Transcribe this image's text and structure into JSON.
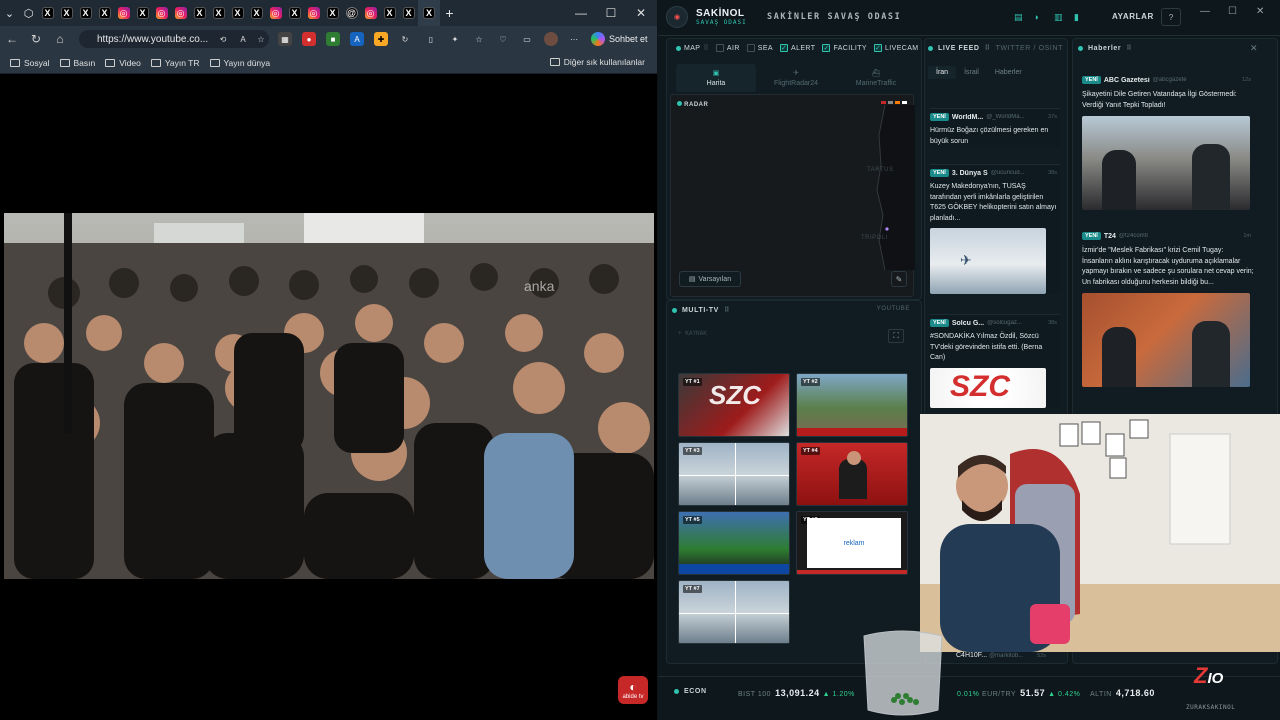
{
  "browser": {
    "tabs": [
      "x",
      "x",
      "x",
      "x",
      "ig",
      "x",
      "ig",
      "ig",
      "x",
      "x",
      "x",
      "x",
      "ig",
      "x",
      "ig",
      "x",
      "th",
      "ig",
      "x",
      "x",
      "x"
    ],
    "url": "https://www.youtube.co...",
    "chat_label": "Sohbet et",
    "bookmarks": [
      "Sosyal",
      "Basın",
      "Video",
      "Yayın TR",
      "Yayın dünya"
    ],
    "other_bookmarks": "Diğer sık kullanılanlar",
    "video_watermark": "anka",
    "player_logo": "abide tv"
  },
  "dashboard": {
    "brand": "SAKİNOL",
    "brand_sub": "SAVAŞ ODASI",
    "title": "SAKİNLER SAVAŞ ODASI",
    "settings_label": "AYARLAR",
    "help_label": "?",
    "map_filters": [
      {
        "label": "MAP",
        "checked": false,
        "dot": true
      },
      {
        "label": "AIR",
        "checked": false
      },
      {
        "label": "SEA",
        "checked": false
      },
      {
        "label": "ALERT",
        "checked": true
      },
      {
        "label": "FACILITY",
        "checked": true
      },
      {
        "label": "LIVECAM",
        "checked": true
      }
    ],
    "map_tabs": [
      "Harita",
      "FlightRadar24",
      "MarineTraffic"
    ],
    "radar_label": "RADAR",
    "map_places": [
      "TARTUS",
      "TRIPOLI"
    ],
    "default_view": "Varsayılan",
    "multitv_label": "MULTI-TV",
    "multitv_source": "YOUTUBE",
    "add_source": "+ KAYNAK",
    "tv_tags": [
      "YT #1",
      "YT #2",
      "YT #3",
      "YT #4",
      "YT #5",
      "YT #6",
      "YT #7"
    ],
    "tv_ad_text": "reklam",
    "live_feed_label": "LIVE FEED",
    "live_feed_sub": "TWITTER / OSINT",
    "feed_tabs": [
      "İran",
      "İsrail",
      "Haberler"
    ],
    "feed": [
      {
        "badge": "YENİ",
        "source": "WorldM...",
        "handle": "@_WorldMa...",
        "ago": "37s",
        "text": "Hürmüz Boğazı çözülmesi gereken en büyük sorun"
      },
      {
        "badge": "YENİ",
        "source": "3. Dünya S...",
        "handle": "@ucuncud...",
        "ago": "38s",
        "text": "Kuzey Makedonya'nın, TUSAŞ tarafından yerli imkânlarla geliştirilen T625 GÖKBEY helikopterini satın almayı planladı..."
      },
      {
        "badge": "YENİ",
        "source": "Solcu G...",
        "handle": "@solcugaz...",
        "ago": "38s",
        "text": "#SONDAKİKA Yılmaz Özdil, Sözcü TV'deki görevinden istifa etti. (Berna Can)"
      }
    ],
    "feed_img_text": "SZC",
    "last_feed_source": "C4H10F...",
    "last_feed_handle": "@markitob...",
    "last_feed_ago": "52s",
    "news_label": "Haberler",
    "news": [
      {
        "badge": "YENİ",
        "source": "ABC Gazetesi",
        "handle": "@abcgazete",
        "ago": "12s",
        "text": "Şikayetini Dile Getiren Vatandaşa İlgi Göstermedi: Verdiği Yanıt Tepki Topladı!"
      },
      {
        "badge": "YENİ",
        "source": "T24",
        "handle": "@t24comtr",
        "ago": "1m",
        "text": "İzmir'de \"Meslek Fabrikası\" krizi Cemil Tugay: İnsanların aklını karıştıracak uyduruma açıklamalar yapmayı bırakın ve sadece şu sorulara net cevap verin; Un fabrikası olduğunu herkesin bildiği bu..."
      }
    ],
    "econ_label": "ECON",
    "tickers": [
      {
        "name": "BIST 100",
        "value": "13,091.24",
        "change": "▲ 1.20%"
      },
      {
        "name": "",
        "value": "",
        "change": "0.01%"
      },
      {
        "name": "EUR/TRY",
        "value": "51.57",
        "change": "▲ 0.42%"
      },
      {
        "name": "ALTIN",
        "value": "4,718.60",
        "change": ""
      }
    ]
  },
  "overlay": {
    "logo_main": "Z",
    "logo_accent": "IO",
    "logo_sub": "ZURAKSAKINOL"
  },
  "colors": {
    "accent": "#2fc3b0",
    "up": "#2fd38f",
    "alert": "#e53935"
  }
}
